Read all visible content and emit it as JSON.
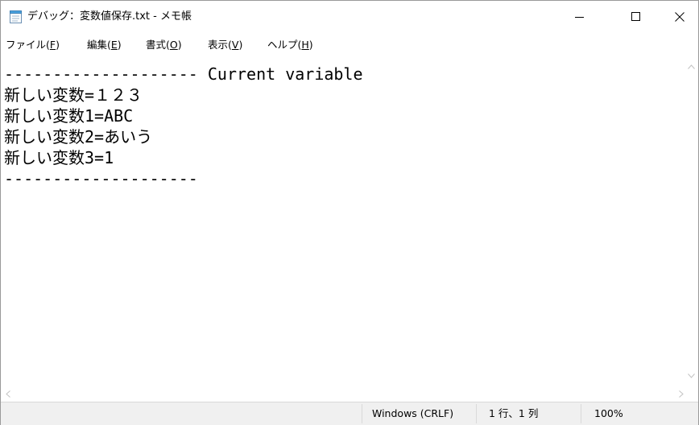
{
  "window": {
    "title": "デバッグ：変数値保存.txt - メモ帳"
  },
  "menu": [
    {
      "label": "ファイル(",
      "key": "F",
      "end": ")"
    },
    {
      "label": "編集(",
      "key": "E",
      "end": ")"
    },
    {
      "label": "書式(",
      "key": "O",
      "end": ")"
    },
    {
      "label": "表示(",
      "key": "V",
      "end": ")"
    },
    {
      "label": "ヘルプ(",
      "key": "H",
      "end": ")"
    }
  ],
  "editor": {
    "lines": [
      "-------------------- Current variable",
      "新しい変数=１２３",
      "新しい変数1=ABC",
      "新しい変数2=あいう",
      "新しい変数3=1",
      "--------------------"
    ]
  },
  "status": {
    "line_ending": "Windows (CRLF)",
    "position": "1 行、1 列",
    "zoom": "100%"
  },
  "icons": {
    "app": "notepad-icon",
    "minimize": "minimize-icon",
    "maximize": "maximize-icon",
    "close": "close-icon"
  }
}
